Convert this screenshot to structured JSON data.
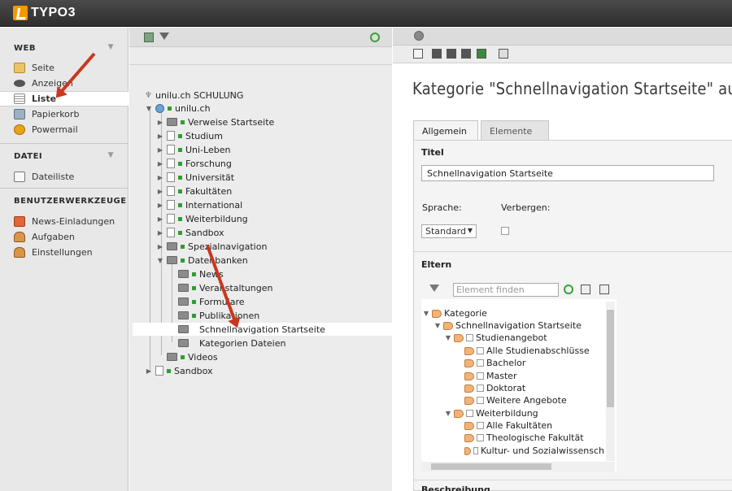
{
  "app": {
    "logo_text": "TYPO3",
    "brand_color": "#f49700"
  },
  "module_menu": {
    "sections": [
      {
        "title": "WEB",
        "items": [
          {
            "label": "Seite",
            "icon": "page-icon"
          },
          {
            "label": "Anzeigen",
            "icon": "eye-icon"
          },
          {
            "label": "Liste",
            "icon": "list-icon",
            "active": true
          },
          {
            "label": "Papierkorb",
            "icon": "trash-icon"
          },
          {
            "label": "Powermail",
            "icon": "powermail-icon"
          }
        ]
      },
      {
        "title": "DATEI",
        "items": [
          {
            "label": "Dateiliste",
            "icon": "folder-list-icon"
          }
        ]
      },
      {
        "title": "BENUTZERWERKZEUGE",
        "items": [
          {
            "label": "News-Einladungen",
            "icon": "news-icon"
          },
          {
            "label": "Aufgaben",
            "icon": "tasks-icon"
          },
          {
            "label": "Einstellungen",
            "icon": "user-settings-icon"
          }
        ]
      }
    ]
  },
  "page_tree": {
    "root": "unilu.ch SCHULUNG",
    "site": "unilu.ch",
    "nodes": [
      "Verweise Startseite",
      "Studium",
      "Uni-Leben",
      "Forschung",
      "Universität",
      "Fakultäten",
      "International",
      "Weiterbildung",
      "Sandbox",
      "Spezialnavigation",
      "Datenbanken"
    ],
    "datenbanken_children": [
      "News",
      "Veranstaltungen",
      "Formulare",
      "Publikationen",
      "Schnellnavigation Startseite",
      "Kategorien Dateien"
    ],
    "after": [
      "Videos"
    ],
    "bottom": "Sandbox"
  },
  "editor": {
    "title": "Kategorie \"Schnellnavigation Startseite\" au",
    "tabs": [
      "Allgemein",
      "Elemente"
    ],
    "titel_label": "Titel",
    "titel_value": "Schnellnavigation Startseite",
    "sprache_label": "Sprache:",
    "verbergen_label": "Verbergen:",
    "sprache_value": "Standard",
    "eltern_label": "Eltern",
    "find_placeholder": "Element finden",
    "beschreibung_label": "Beschreibung"
  },
  "category_tree": [
    "Kategorie",
    "Schnellnavigation Startseite",
    "Studienangebot",
    "Alle Studienabschlüsse",
    "Bachelor",
    "Master",
    "Doktorat",
    "Weitere Angebote",
    "Weiterbildung",
    "Alle Fakultäten",
    "Theologische Fakultät",
    "Kultur- und Sozialwissensch"
  ]
}
